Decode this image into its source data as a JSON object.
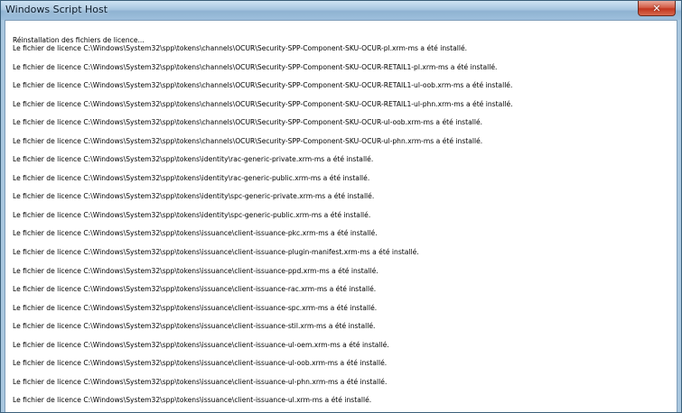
{
  "window": {
    "title": "Windows Script Host",
    "close_glyph": "✕"
  },
  "content": {
    "header": "Réinstallation des fichiers de licence...",
    "lines": [
      "Le fichier de licence C:\\Windows\\System32\\spp\\tokens\\channels\\OCUR\\Security-SPP-Component-SKU-OCUR-pl.xrm-ms a été installé.",
      "Le fichier de licence C:\\Windows\\System32\\spp\\tokens\\channels\\OCUR\\Security-SPP-Component-SKU-OCUR-RETAIL1-pl.xrm-ms a été installé.",
      "Le fichier de licence C:\\Windows\\System32\\spp\\tokens\\channels\\OCUR\\Security-SPP-Component-SKU-OCUR-RETAIL1-ul-oob.xrm-ms a été installé.",
      "Le fichier de licence C:\\Windows\\System32\\spp\\tokens\\channels\\OCUR\\Security-SPP-Component-SKU-OCUR-RETAIL1-ul-phn.xrm-ms a été installé.",
      "Le fichier de licence C:\\Windows\\System32\\spp\\tokens\\channels\\OCUR\\Security-SPP-Component-SKU-OCUR-ul-oob.xrm-ms a été installé.",
      "Le fichier de licence C:\\Windows\\System32\\spp\\tokens\\channels\\OCUR\\Security-SPP-Component-SKU-OCUR-ul-phn.xrm-ms a été installé.",
      "Le fichier de licence C:\\Windows\\System32\\spp\\tokens\\identity\\rac-generic-private.xrm-ms a été installé.",
      "Le fichier de licence C:\\Windows\\System32\\spp\\tokens\\identity\\rac-generic-public.xrm-ms a été installé.",
      "Le fichier de licence C:\\Windows\\System32\\spp\\tokens\\identity\\spc-generic-private.xrm-ms a été installé.",
      "Le fichier de licence C:\\Windows\\System32\\spp\\tokens\\identity\\spc-generic-public.xrm-ms a été installé.",
      "Le fichier de licence C:\\Windows\\System32\\spp\\tokens\\issuance\\client-issuance-pkc.xrm-ms a été installé.",
      "Le fichier de licence C:\\Windows\\System32\\spp\\tokens\\issuance\\client-issuance-plugin-manifest.xrm-ms a été installé.",
      "Le fichier de licence C:\\Windows\\System32\\spp\\tokens\\issuance\\client-issuance-ppd.xrm-ms a été installé.",
      "Le fichier de licence C:\\Windows\\System32\\spp\\tokens\\issuance\\client-issuance-rac.xrm-ms a été installé.",
      "Le fichier de licence C:\\Windows\\System32\\spp\\tokens\\issuance\\client-issuance-spc.xrm-ms a été installé.",
      "Le fichier de licence C:\\Windows\\System32\\spp\\tokens\\issuance\\client-issuance-stil.xrm-ms a été installé.",
      "Le fichier de licence C:\\Windows\\System32\\spp\\tokens\\issuance\\client-issuance-ul-oem.xrm-ms a été installé.",
      "Le fichier de licence C:\\Windows\\System32\\spp\\tokens\\issuance\\client-issuance-ul-oob.xrm-ms a été installé.",
      "Le fichier de licence C:\\Windows\\System32\\spp\\tokens\\issuance\\client-issuance-ul-phn.xrm-ms a été installé.",
      "Le fichier de licence C:\\Windows\\System32\\spp\\tokens\\issuance\\client-issuance-ul.xrm-ms a été installé."
    ]
  }
}
